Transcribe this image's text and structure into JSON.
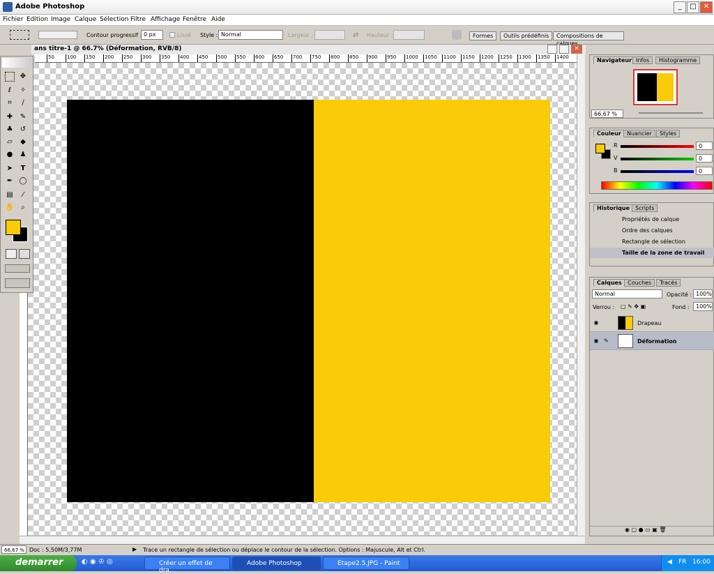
{
  "window": {
    "title": "Adobe Photoshop",
    "min": "_",
    "max": "□",
    "close": "✕"
  },
  "menu": [
    "Fichier",
    "Edition",
    "Image",
    "Calque",
    "Sélection",
    "Filtre",
    "Affichage",
    "Fenêtre",
    "Aide"
  ],
  "options": {
    "feather_label": "Contour progressif :",
    "feather_value": "0 px",
    "antialias_label": "Lissé",
    "style_label": "Style :",
    "style_value": "Normal",
    "width_label": "Largeur :",
    "height_label": "Hauteur :",
    "tabs": [
      "Formes",
      "Outils prédéfinis",
      "Compositions de calques"
    ]
  },
  "document": {
    "title": "ans titre-1 @ 66.7% (Déformation, RVB/8)",
    "ruler_ticks": [
      "50",
      "100",
      "150",
      "200",
      "250",
      "300",
      "350",
      "400",
      "450",
      "500",
      "550",
      "600",
      "650",
      "700",
      "750",
      "800",
      "850",
      "900",
      "950",
      "1000",
      "1050",
      "1100",
      "1150",
      "1200",
      "1250",
      "1300",
      "1350",
      "1400"
    ],
    "left_color": "#000000",
    "right_color": "#f9cb08"
  },
  "status": {
    "zoom": "66,67 %",
    "doc": "Doc : 5,50M/3,77M",
    "hint": "Trace un rectangle de sélection ou déplace le contour de la sélection. Options : Majuscule, Alt et Ctrl."
  },
  "navigator": {
    "tabs": [
      "Navigateur",
      "Infos",
      "Histogramme"
    ],
    "zoom": "66,67 %"
  },
  "color": {
    "tabs": [
      "Couleur",
      "Nuancier",
      "Styles"
    ],
    "r_label": "R",
    "v_label": "V",
    "b_label": "B",
    "r": "0",
    "v": "0",
    "b": "0",
    "fg": "#f9cb08",
    "bg": "#000000"
  },
  "history": {
    "tabs": [
      "Historique",
      "Scripts"
    ],
    "items": [
      "Propriétés de calque",
      "Ordre des calques",
      "Rectangle de sélection",
      "Taille de la zone de travail"
    ]
  },
  "layers": {
    "tabs": [
      "Calques",
      "Couches",
      "Tracés"
    ],
    "blend": "Normal",
    "opacity_label": "Opacité :",
    "opacity": "100%",
    "lock_label": "Verrou :",
    "fill_label": "Fond :",
    "fill": "100%",
    "items": [
      "Drapeau",
      "Déformation"
    ]
  },
  "taskbar": {
    "start": "demarrer",
    "tasks": [
      "Créer un effet de dra...",
      "Adobe Photoshop",
      "Etape2.5.JPG - Paint"
    ],
    "clock": "16:00",
    "lang": "FR"
  }
}
